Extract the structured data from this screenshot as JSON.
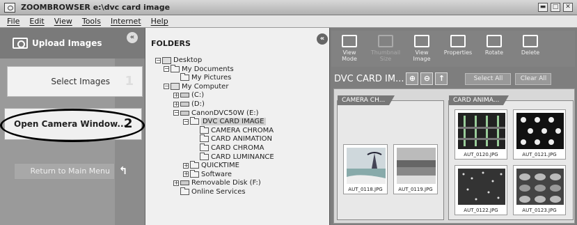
{
  "window": {
    "title": "ZOOMBROWSER e:\\dvc card image"
  },
  "menu": {
    "items": [
      "File",
      "Edit",
      "View",
      "Tools",
      "Internet",
      "Help"
    ]
  },
  "left_panel": {
    "upload_label": "Upload Images",
    "select_label": "Select Images",
    "select_step": "1",
    "camera_label": "Open Camera Window...",
    "camera_step": "2",
    "return_label": "Return to Main Menu"
  },
  "folders": {
    "header": "FOLDERS",
    "tree": [
      {
        "label": "Desktop",
        "icon": "desktop",
        "expander": "−"
      },
      {
        "label": "My Documents",
        "icon": "folder",
        "expander": "−"
      },
      {
        "label": "My Pictures",
        "icon": "folder",
        "expander": ""
      },
      {
        "label": "My Computer",
        "icon": "computer",
        "expander": "−"
      },
      {
        "label": "(C:)",
        "icon": "drive",
        "expander": "+"
      },
      {
        "label": "(D:)",
        "icon": "drive",
        "expander": "+"
      },
      {
        "label": "CanonDVC50W (E:)",
        "icon": "drive",
        "expander": "−"
      },
      {
        "label": "DVC CARD IMAGE",
        "icon": "folder",
        "expander": "−",
        "selected": true
      },
      {
        "label": "CAMERA CHROMA",
        "icon": "folder",
        "expander": ""
      },
      {
        "label": "CARD ANIMATION",
        "icon": "folder",
        "expander": ""
      },
      {
        "label": "CARD CHROMA",
        "icon": "folder",
        "expander": ""
      },
      {
        "label": "CARD LUMINANCE",
        "icon": "folder",
        "expander": ""
      },
      {
        "label": "QUICKTIME",
        "icon": "folder",
        "expander": "+"
      },
      {
        "label": "Software",
        "icon": "folder",
        "expander": "+"
      },
      {
        "label": "Removable Disk (F:)",
        "icon": "drive",
        "expander": "+"
      },
      {
        "label": "Online Services",
        "icon": "folder",
        "expander": ""
      }
    ]
  },
  "toolbar": {
    "tools": [
      {
        "label": "View\nMode",
        "icon": "view-mode-icon",
        "enabled": true
      },
      {
        "label": "Thumbnail\nSize",
        "icon": "thumbnail-size-icon",
        "enabled": false
      },
      {
        "label": "View\nImage",
        "icon": "view-image-icon",
        "enabled": true
      },
      {
        "label": "Properties",
        "icon": "properties-icon",
        "enabled": true
      },
      {
        "label": "Rotate",
        "icon": "rotate-icon",
        "enabled": true
      },
      {
        "label": "Delete",
        "icon": "delete-icon",
        "enabled": true
      }
    ]
  },
  "browser": {
    "path": "DVC CARD IM...",
    "select_all": "Select All",
    "clear_all": "Clear All",
    "groups": [
      {
        "name": "CAMERA CH...",
        "thumbs": [
          "AUT_0118.JPG",
          "AUT_0119.JPG"
        ]
      },
      {
        "name": "CARD ANIMA...",
        "thumbs": [
          "AUT_0120.JPG",
          "AUT_0121.JPG",
          "AUT_0122.JPG",
          "AUT_0123.JPG"
        ]
      }
    ]
  }
}
